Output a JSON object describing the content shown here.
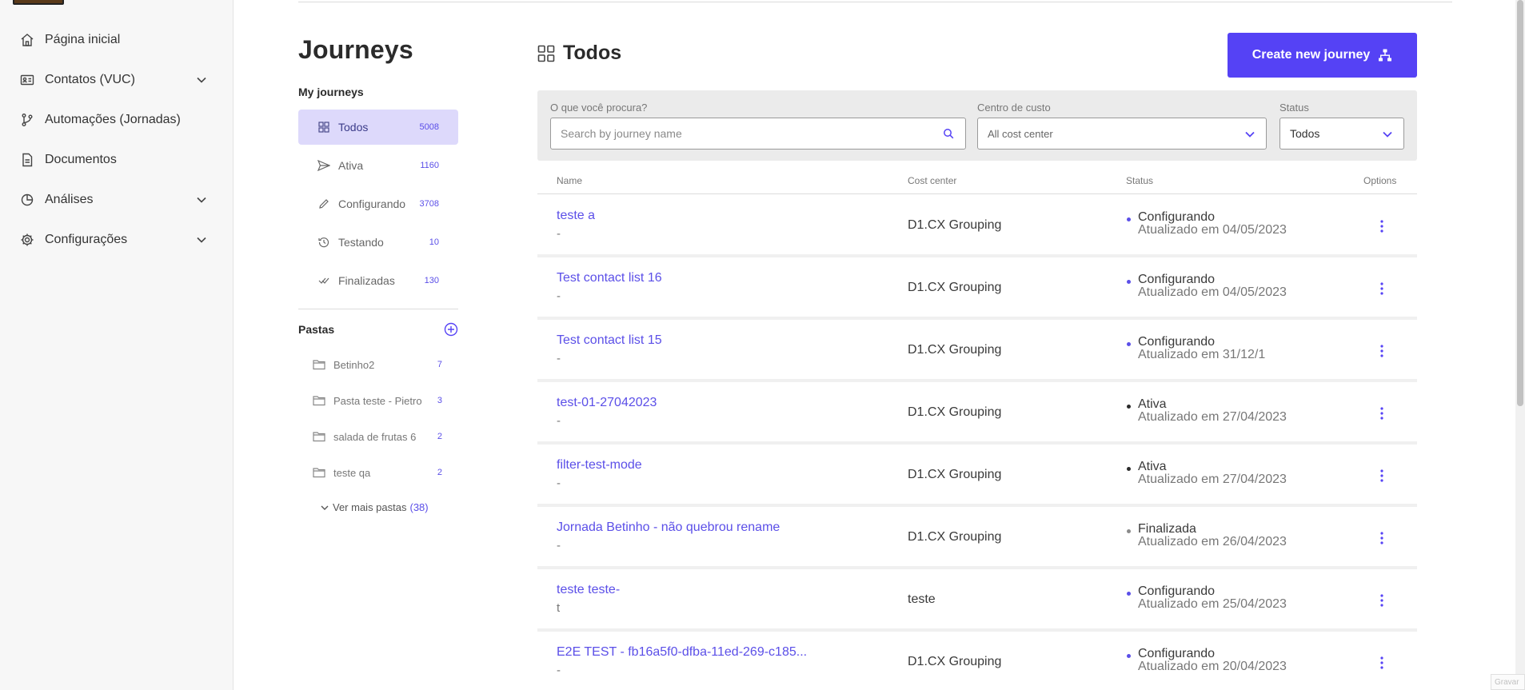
{
  "sidebar": {
    "items": [
      {
        "label": "Página inicial",
        "icon": "home-icon",
        "expandable": false
      },
      {
        "label": "Contatos (VUC)",
        "icon": "contact-card-icon",
        "expandable": true
      },
      {
        "label": "Automações (Jornadas)",
        "icon": "branch-icon",
        "expandable": false
      },
      {
        "label": "Documentos",
        "icon": "document-icon",
        "expandable": false
      },
      {
        "label": "Análises",
        "icon": "pie-chart-icon",
        "expandable": true
      },
      {
        "label": "Configurações",
        "icon": "gear-icon",
        "expandable": true
      }
    ]
  },
  "journeys_panel": {
    "title": "Journeys",
    "my_journeys_label": "My journeys",
    "items": [
      {
        "label": "Todos",
        "count": "5008",
        "icon": "grid-icon",
        "active": true
      },
      {
        "label": "Ativa",
        "count": "1160",
        "icon": "send-icon",
        "active": false
      },
      {
        "label": "Configurando",
        "count": "3708",
        "icon": "pencil-icon",
        "active": false
      },
      {
        "label": "Testando",
        "count": "10",
        "icon": "history-icon",
        "active": false
      },
      {
        "label": "Finalizadas",
        "count": "130",
        "icon": "double-check-icon",
        "active": false
      }
    ],
    "folders_label": "Pastas",
    "folders": [
      {
        "label": "Betinho2",
        "count": "7"
      },
      {
        "label": "Pasta teste - Pietro",
        "count": "3"
      },
      {
        "label": "salada de frutas 6",
        "count": "2"
      },
      {
        "label": "teste qa",
        "count": "2"
      }
    ],
    "see_more_label": "Ver mais pastas",
    "see_more_count": "(38)"
  },
  "main": {
    "title": "Todos",
    "create_button_label": "Create new journey",
    "filters": {
      "search_label": "O que você procura?",
      "search_placeholder": "Search by journey name",
      "cost_center_label": "Centro de custo",
      "cost_center_value": "All cost center",
      "status_label": "Status",
      "status_value": "Todos"
    },
    "table": {
      "headers": {
        "name": "Name",
        "cost_center": "Cost center",
        "status": "Status",
        "options": "Options"
      },
      "rows": [
        {
          "name": "teste a",
          "sub": "-",
          "cost_center": "D1.CX Grouping",
          "status": "Configurando",
          "updated": "Atualizado em 04/05/2023",
          "dot_color": "#5b4fe8"
        },
        {
          "name": "Test contact list 16",
          "sub": "-",
          "cost_center": "D1.CX Grouping",
          "status": "Configurando",
          "updated": "Atualizado em 04/05/2023",
          "dot_color": "#5b4fe8"
        },
        {
          "name": "Test contact list 15",
          "sub": "-",
          "cost_center": "D1.CX Grouping",
          "status": "Configurando",
          "updated": "Atualizado em 31/12/1",
          "dot_color": "#5b4fe8"
        },
        {
          "name": "test-01-27042023",
          "sub": "-",
          "cost_center": "D1.CX Grouping",
          "status": "Ativa",
          "updated": "Atualizado em 27/04/2023",
          "dot_color": "#2b2b2b"
        },
        {
          "name": "filter-test-mode",
          "sub": "-",
          "cost_center": "D1.CX Grouping",
          "status": "Ativa",
          "updated": "Atualizado em 27/04/2023",
          "dot_color": "#2b2b2b"
        },
        {
          "name": "Jornada Betinho - não quebrou rename",
          "sub": "-",
          "cost_center": "D1.CX Grouping",
          "status": "Finalizada",
          "updated": "Atualizado em 26/04/2023",
          "dot_color": "#8a8a8a"
        },
        {
          "name": "teste teste-",
          "sub": "t",
          "cost_center": "teste",
          "status": "Configurando",
          "updated": "Atualizado em 25/04/2023",
          "dot_color": "#5b4fe8"
        },
        {
          "name": "E2E TEST - fb16a5f0-dfba-11ed-269-c185...",
          "sub": "-",
          "cost_center": "D1.CX Grouping",
          "status": "Configurando",
          "updated": "Atualizado em 20/04/2023",
          "dot_color": "#5b4fe8"
        }
      ]
    }
  },
  "corner_tag": "Gravar",
  "colors": {
    "accent": "#5542f5",
    "link": "#5b4fe8",
    "active_bg": "#ddd9fb"
  }
}
